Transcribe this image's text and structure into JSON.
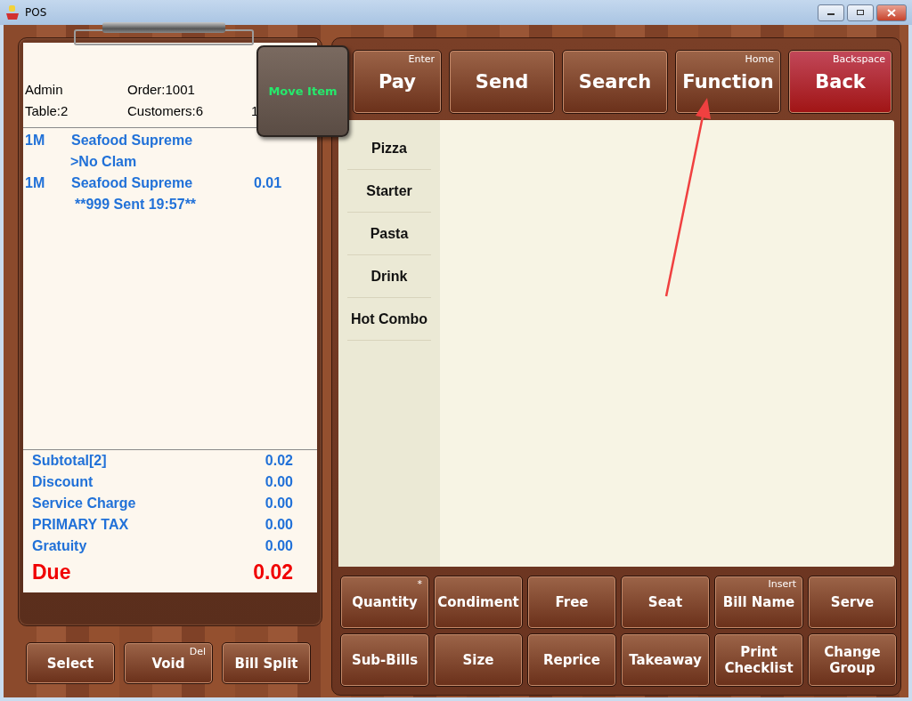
{
  "window": {
    "title": "POS"
  },
  "order": {
    "header": [
      {
        "text": "Admin"
      },
      {
        "text": "Order:1001"
      }
    ],
    "header_row2": [
      {
        "text": "Table:2"
      },
      {
        "text": "Customers:6"
      },
      {
        "text": "1"
      }
    ],
    "lines": [
      {
        "qty": "1M",
        "name": "Seafood Supreme",
        "kind": "item"
      },
      {
        "name": ">No Clam",
        "kind": "modifier"
      },
      {
        "qty": "1M",
        "name": "Seafood Supreme",
        "price": "0.01",
        "kind": "item"
      },
      {
        "name": "**999 Sent 19:57**",
        "kind": "note"
      }
    ],
    "totals": [
      {
        "label": "Subtotal[2]",
        "value": "0.02",
        "kind": "normal"
      },
      {
        "label": "Discount",
        "value": "0.00",
        "kind": "normal"
      },
      {
        "label": "Service Charge",
        "value": "0.00",
        "kind": "normal"
      },
      {
        "label": "PRIMARY TAX",
        "value": "0.00",
        "kind": "normal"
      },
      {
        "label": "Gratuity",
        "value": "0.00",
        "kind": "normal"
      },
      {
        "label": "Due",
        "value": "0.02",
        "kind": "due"
      }
    ]
  },
  "popup": {
    "label": "Move Item"
  },
  "order_buttons": [
    {
      "label": "Select"
    },
    {
      "label": "Void",
      "hotkey": "Del"
    },
    {
      "label": "Bill Split"
    }
  ],
  "top_buttons": [
    {
      "label": "Pay",
      "hotkey": "Enter",
      "kind": "normal"
    },
    {
      "label": "Send",
      "kind": "normal"
    },
    {
      "label": "Search",
      "kind": "normal"
    },
    {
      "label": "Function",
      "hotkey": "Home",
      "kind": "normal"
    },
    {
      "label": "Back",
      "hotkey": "Backspace",
      "kind": "danger"
    }
  ],
  "categories": [
    {
      "label": "Pizza"
    },
    {
      "label": "Starter"
    },
    {
      "label": "Pasta"
    },
    {
      "label": "Drink"
    },
    {
      "label": "Hot Combo"
    }
  ],
  "function_buttons": [
    {
      "label": "Quantity",
      "hotkey": "*"
    },
    {
      "label": "Condiment"
    },
    {
      "label": "Free"
    },
    {
      "label": "Seat"
    },
    {
      "label": "Bill Name",
      "hotkey": "Insert"
    },
    {
      "label": "Serve"
    },
    {
      "label": "Sub-Bills"
    },
    {
      "label": "Size"
    },
    {
      "label": "Reprice"
    },
    {
      "label": "Takeaway"
    },
    {
      "label": "Print Checklist"
    },
    {
      "label": "Change Group"
    }
  ]
}
